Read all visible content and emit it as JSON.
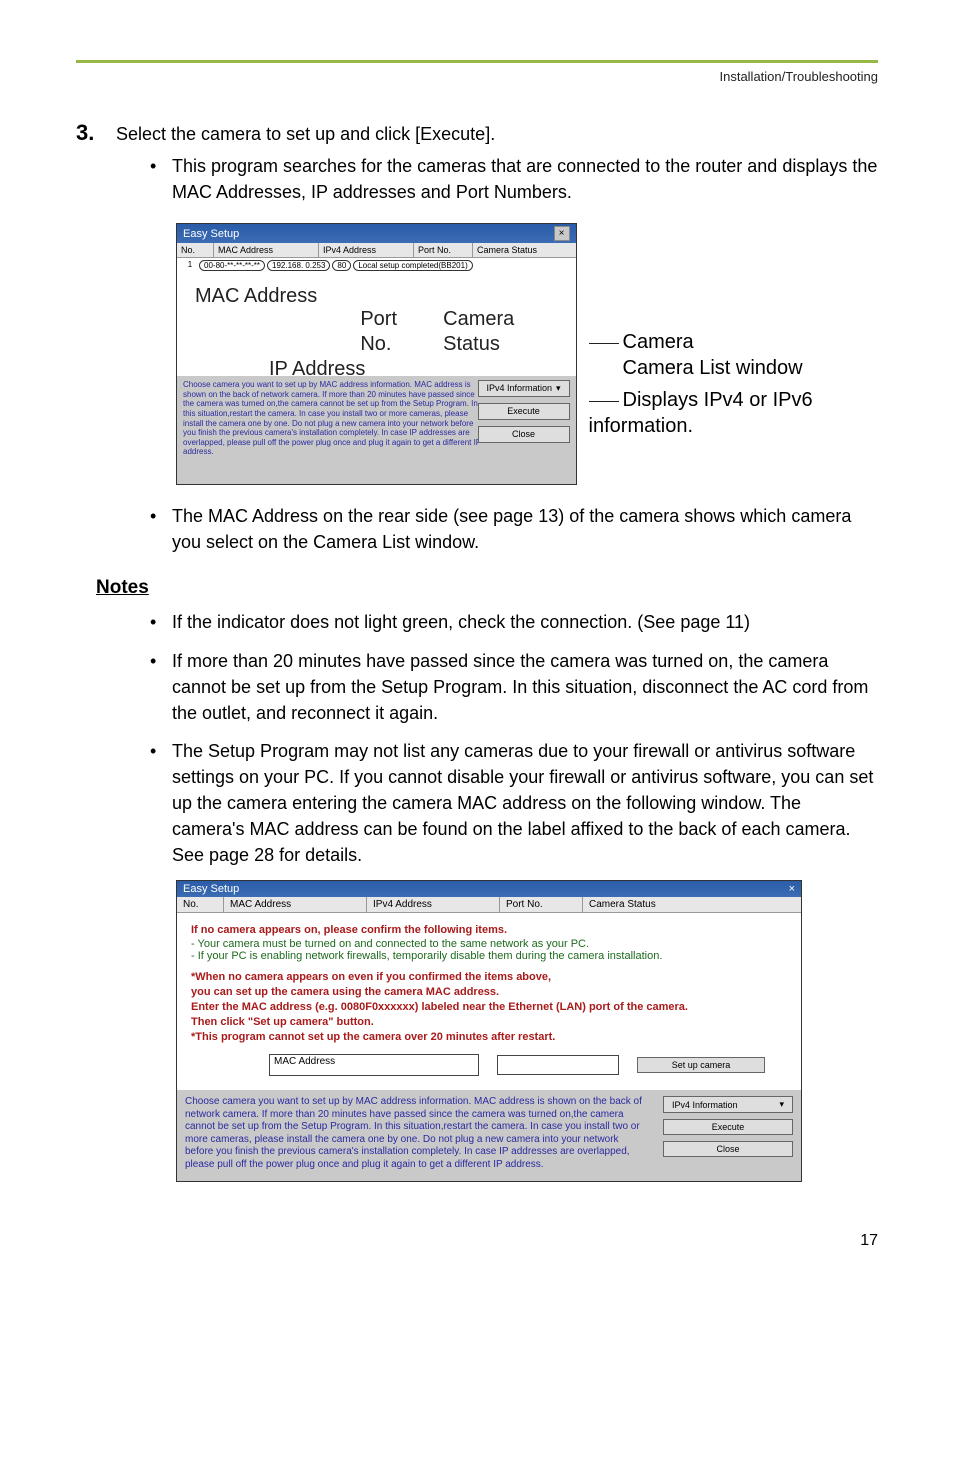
{
  "header": {
    "section_title": "Installation/Troubleshooting"
  },
  "step": {
    "number": "3.",
    "text": "Select the camera to set up and click [Execute].",
    "sub_bullets": [
      "This program searches for the cameras that are connected to the router and displays the MAC Addresses, IP addresses and Port Numbers."
    ],
    "after_figure_bullets": [
      "The MAC Address on the rear side (see page 13) of the camera shows which camera you select on the Camera List window."
    ]
  },
  "figure1": {
    "dialog_title": "Easy Setup",
    "columns": {
      "no": "No.",
      "mac": "MAC Address",
      "ip": "IPv4 Address",
      "port": "Port No.",
      "status": "Camera Status"
    },
    "row": {
      "no": "1",
      "mac": "00-80-**-**-**-**",
      "ip": "192.168.  0.253",
      "port": "80",
      "status": "Local setup completed(BB201)"
    },
    "annot": {
      "mac_label": "MAC Address",
      "port_label": "Port No.",
      "camera_status_label": "Camera Status",
      "ip_label": "IP Address"
    },
    "info_text": "Choose camera you want to set up by MAC address information. MAC address is shown on the back of network camera. If more than 20 minutes have passed since the camera was turned on,the camera cannot be set up from the Setup Program. In this situation,restart the camera. In case you install two or more cameras, please install the camera one by one. Do not plug a new camera into your network before you finish the previous camera's installation completely. In case IP addresses are overlapped, please pull off the power plug once and plug it again to get a different IP address.",
    "dropdown": "IPv4 Information",
    "btn_execute": "Execute",
    "btn_close": "Close",
    "side": {
      "camera_list": "Camera List window",
      "displays": "Displays IPv4 or IPv6 information."
    }
  },
  "notes": {
    "heading": "Notes",
    "items": [
      "If the indicator does not light green, check the connection. (See page 11)",
      "If more than 20 minutes have passed since the camera was turned on, the camera cannot be set up from the Setup Program. In this situation, disconnect the AC cord from the outlet, and reconnect it again.",
      "The Setup Program may not list any cameras due to your firewall or antivirus software settings on your PC. If you cannot disable your firewall or antivirus software, you can set up the camera entering the camera MAC address on the following window. The camera's MAC address can be found on the label affixed to the back of each camera. See page 28 for details."
    ]
  },
  "figure2": {
    "dialog_title": "Easy Setup",
    "columns": {
      "no": "No.",
      "mac": "MAC Address",
      "ip": "IPv4 Address",
      "port": "Port No.",
      "status": "Camera Status"
    },
    "red_heading": "If no camera appears on, please confirm the following items.",
    "green_lines": [
      "- Your camera must be turned on and connected to the same network as your PC.",
      "- If your PC is enabling network firewalls, temporarily disable them during the camera installation."
    ],
    "red_block": [
      "*When no camera appears on even if you confirmed the items above,",
      "you can set up the camera using the camera MAC address.",
      "Enter the MAC address (e.g. 0080F0xxxxxx) labeled near the Ethernet (LAN) port of the camera.",
      "Then click \"Set up camera\" button.",
      "*This program cannot set up the camera over 20 minutes after restart."
    ],
    "mac_label": "MAC Address",
    "btn_setup": "Set up camera",
    "footer_text": "Choose camera you want to set up by MAC address information. MAC address is shown on the back of network camera. If more than 20 minutes have passed since the camera was turned on,the camera cannot be set up from the Setup Program. In this situation,restart the camera. In case you install two or more cameras, please install the camera one by one. Do not plug a new camera into your network before you finish the previous camera's installation completely. In case IP addresses are overlapped, please pull off the power plug once and plug it again to get a different IP address.",
    "dropdown": "IPv4 Information",
    "btn_execute": "Execute",
    "btn_close": "Close"
  },
  "page_number": "17"
}
